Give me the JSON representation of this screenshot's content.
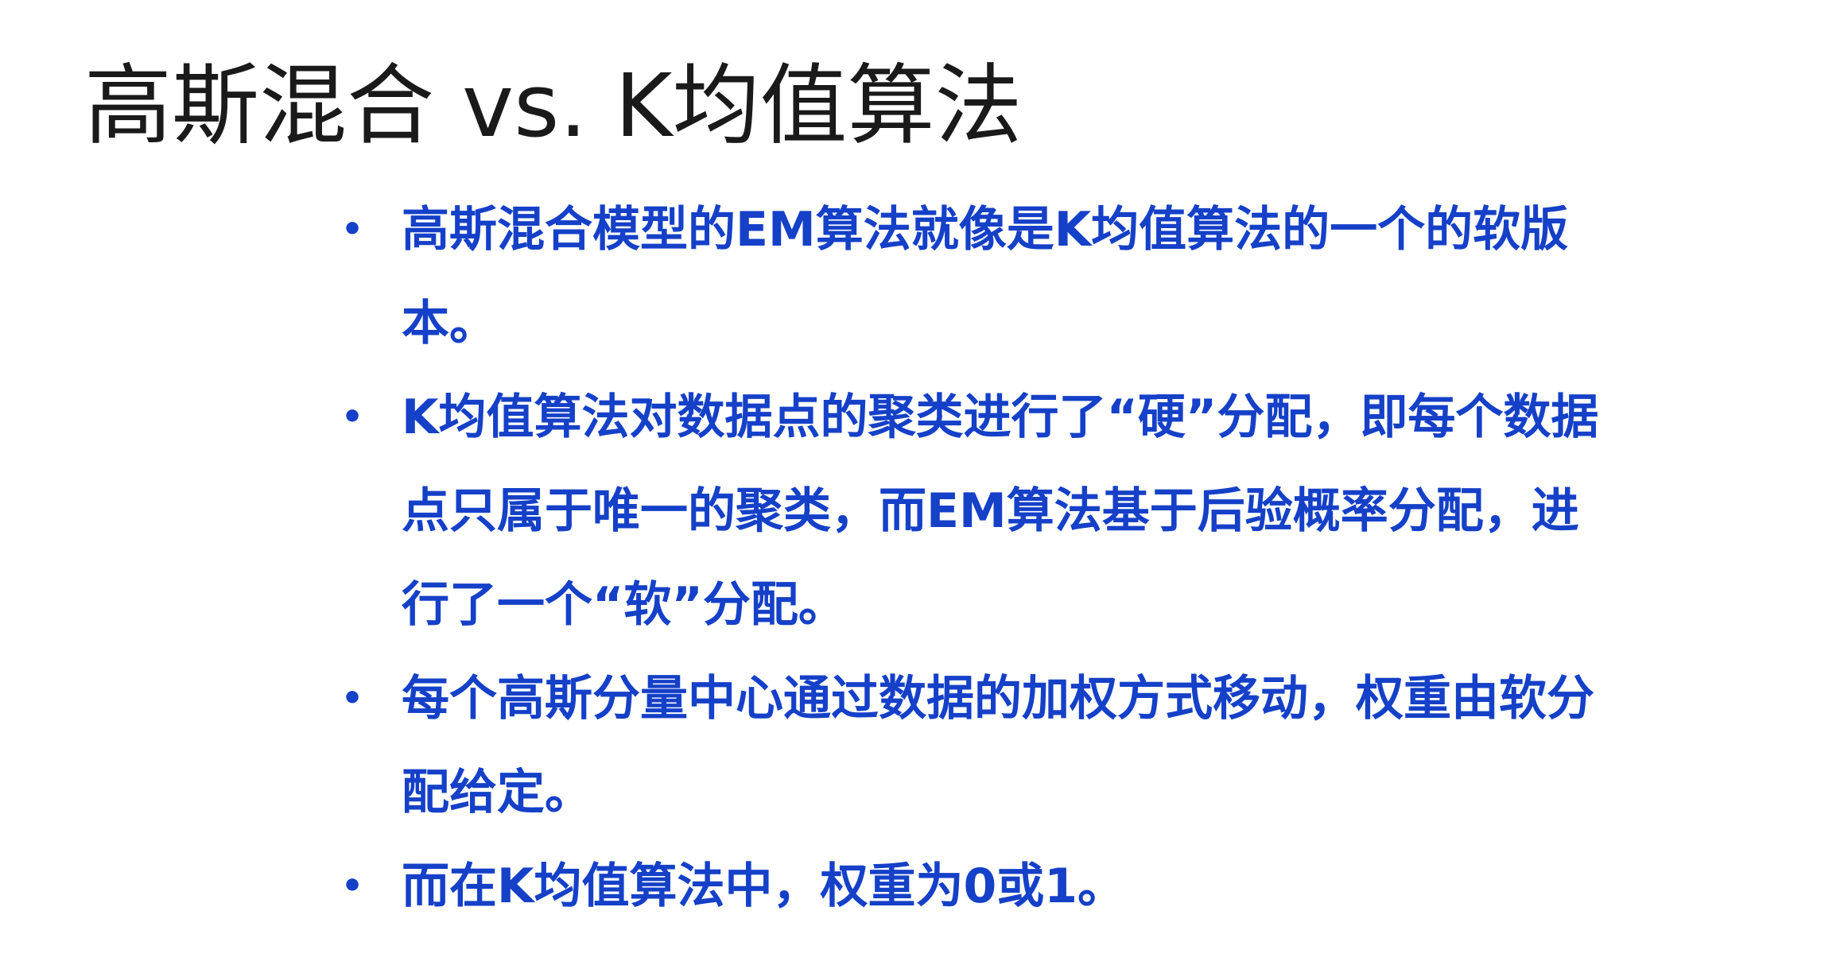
{
  "slide": {
    "title": "高斯混合 vs. K均值算法",
    "bullet_symbol": "•",
    "text_color": "#1540c8",
    "bullets": [
      {
        "text": "高斯混合模型的EM算法就像是K均值算法的一个的软版本。"
      },
      {
        "text": "K均值算法对数据点的聚类进行了“硬”分配，即每个数据点只属于唯一的聚类，而EM算法基于后验概率分配，进行了一个“软”分配。"
      },
      {
        "text": "每个高斯分量中心通过数据的加权方式移动，权重由软分配给定。"
      },
      {
        "text": "而在K均值算法中，权重为0或1。"
      }
    ]
  }
}
